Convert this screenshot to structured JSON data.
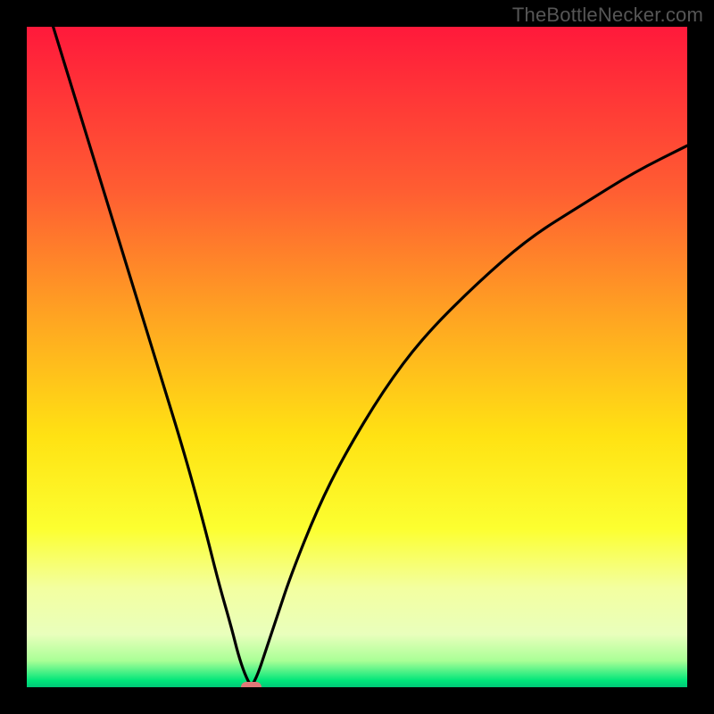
{
  "watermark": {
    "text": "TheBottleNecker.com"
  },
  "colors": {
    "frame": "#000000",
    "gradient_stops": [
      {
        "pct": 0,
        "color": "#ff193b"
      },
      {
        "pct": 25,
        "color": "#ff5e32"
      },
      {
        "pct": 45,
        "color": "#ffa821"
      },
      {
        "pct": 62,
        "color": "#ffe213"
      },
      {
        "pct": 76,
        "color": "#fcff30"
      },
      {
        "pct": 85,
        "color": "#f3ffa0"
      },
      {
        "pct": 92,
        "color": "#e9ffbc"
      },
      {
        "pct": 96,
        "color": "#a9ff96"
      },
      {
        "pct": 99,
        "color": "#00e67a"
      },
      {
        "pct": 100,
        "color": "#00c878"
      }
    ],
    "curve": "#000000",
    "marker": "#e07878"
  },
  "chart_data": {
    "type": "line",
    "title": "",
    "xlabel": "",
    "ylabel": "",
    "xlim": [
      0,
      100
    ],
    "ylim": [
      0,
      100
    ],
    "minimum_x": 34,
    "series": [
      {
        "name": "bottleneck-curve",
        "x": [
          0,
          4,
          8,
          12,
          16,
          20,
          24,
          27,
          29,
          31,
          32,
          33,
          34,
          35,
          36,
          38,
          40,
          44,
          48,
          54,
          60,
          68,
          76,
          84,
          92,
          100
        ],
        "values": [
          113,
          100,
          87,
          74,
          61,
          48,
          35,
          24,
          16,
          9,
          5,
          2,
          0,
          2,
          5,
          11,
          17,
          27,
          35,
          45,
          53,
          61,
          68,
          73,
          78,
          82
        ]
      }
    ],
    "marker": {
      "x": 34,
      "y": 0,
      "w": 3.2,
      "h": 1.6
    }
  }
}
